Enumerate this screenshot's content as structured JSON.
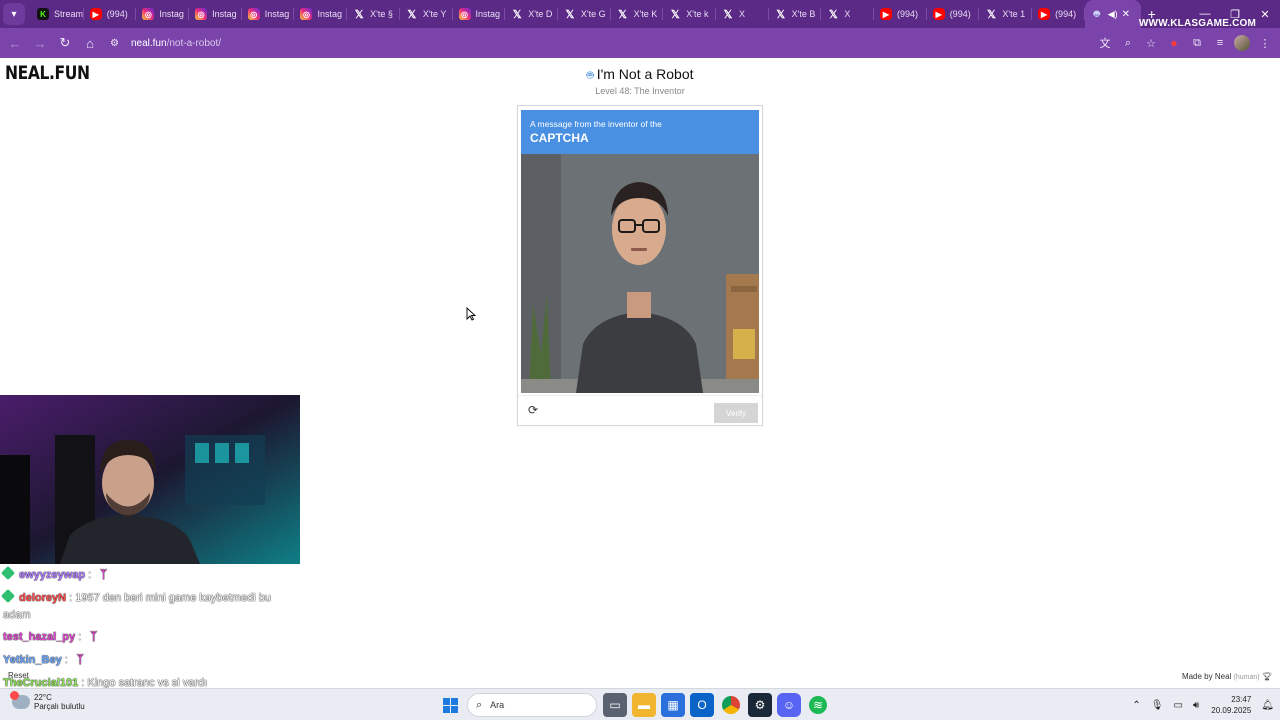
{
  "browser": {
    "tabs": [
      {
        "label": "Stream",
        "icon": "kick-icon"
      },
      {
        "label": "(994)",
        "icon": "youtube-icon"
      },
      {
        "label": "Instag",
        "icon": "instagram-icon"
      },
      {
        "label": "Instag",
        "icon": "instagram-icon"
      },
      {
        "label": "Instag",
        "icon": "instagram-icon"
      },
      {
        "label": "Instag",
        "icon": "instagram-icon"
      },
      {
        "label": "X'te §",
        "icon": "x-icon"
      },
      {
        "label": "X'te Y",
        "icon": "x-icon"
      },
      {
        "label": "Instag",
        "icon": "instagram-icon"
      },
      {
        "label": "X'te D",
        "icon": "x-icon"
      },
      {
        "label": "X'te G",
        "icon": "x-icon"
      },
      {
        "label": "X'te K",
        "icon": "x-icon"
      },
      {
        "label": "X'te k",
        "icon": "x-icon"
      },
      {
        "label": "X",
        "icon": "x-icon"
      },
      {
        "label": "X'te B",
        "icon": "x-icon"
      },
      {
        "label": "X",
        "icon": "x-icon"
      },
      {
        "label": "(994)",
        "icon": "youtube-icon"
      },
      {
        "label": "(994)",
        "icon": "youtube-icon"
      },
      {
        "label": "X'te 1",
        "icon": "x-icon"
      },
      {
        "label": "(994)",
        "icon": "youtube-icon"
      }
    ],
    "watermark": "WWW.KLASGAME.COM",
    "url_host": "neal.fun",
    "url_path": "/not-a-robot/",
    "accent": "#7b44ab"
  },
  "page": {
    "logo": "NEAL.FUN",
    "title": "I'm Not a Robot",
    "subtitle": "Level 48: The Inventor",
    "captcha": {
      "header_small": "A message from the inventor of the",
      "header_big": "CAPTCHA",
      "verify_label": "Verify",
      "header_color": "#4a90e2"
    },
    "made_by": "Made by Neal",
    "made_by_note": "(human)"
  },
  "stream": {
    "chat": [
      {
        "user": "ewyyzeywap",
        "message": "",
        "color": "#b07cff",
        "badge": true,
        "emote": true
      },
      {
        "user": "deloreyN",
        "message": "1957 den beri mini game kaybetmedi bu",
        "color": "#ff4b4b",
        "badge": true,
        "emote": false
      },
      {
        "user": "",
        "message": "adam",
        "color": "#ffffff",
        "badge": false,
        "emote": false
      },
      {
        "user": "test_hazal_py",
        "message": "",
        "color": "#e04ad0",
        "badge": false,
        "emote": true
      },
      {
        "user": "Yetkin_Bey",
        "message": "",
        "color": "#6fa8ff",
        "badge": false,
        "emote": true
      },
      {
        "user": "TheCrucial101",
        "message": "Kingo satranc vs si vardı",
        "color": "#8fe35a",
        "badge": false,
        "emote": false
      }
    ],
    "reset_label": "Reset"
  },
  "taskbar": {
    "weather_temp": "22°C",
    "weather_desc": "Parçalı bulutlu",
    "search_placeholder": "Ara",
    "time": "23:47",
    "date": "20.09.2025"
  }
}
